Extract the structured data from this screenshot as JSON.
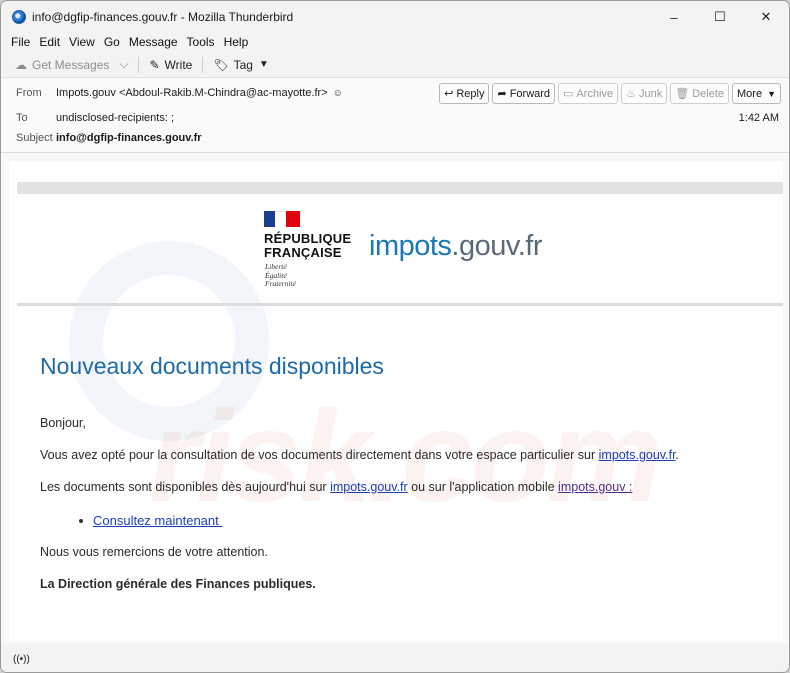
{
  "window": {
    "title": "info@dgfip-finances.gouv.fr - Mozilla Thunderbird",
    "minimize_glyph": "–",
    "maximize_glyph": "☐",
    "close_glyph": "✕"
  },
  "menu": {
    "file": "File",
    "edit": "Edit",
    "view": "View",
    "go": "Go",
    "message": "Message",
    "tools": "Tools",
    "help": "Help"
  },
  "toolbar": {
    "get_messages": "Get Messages",
    "write": "Write",
    "tag": "Tag"
  },
  "header": {
    "from_label": "From",
    "from_value": "Impots.gouv <Abdoul-Rakib.M-Chindra@ac-mayotte.fr>",
    "to_label": "To",
    "to_value": "undisclosed-recipients: ;",
    "subject_label": "Subject",
    "subject_value": "info@dgfip-finances.gouv.fr",
    "time": "1:42 AM",
    "buttons": {
      "reply": "Reply",
      "forward": "Forward",
      "archive": "Archive",
      "junk": "Junk",
      "delete": "Delete",
      "more": "More"
    }
  },
  "email": {
    "logo": {
      "republic_line1": "RÉPUBLIQUE",
      "republic_line2": "FRANÇAISE",
      "motto1": "Liberté",
      "motto2": "Égalité",
      "motto3": "Fraternité",
      "brand_part1": "impots",
      "brand_part2": ".gouv.fr"
    },
    "heading": "Nouveaux documents disponibles",
    "greeting": "Bonjour,",
    "para1_text": "Vous avez opté pour la consultation de vos documents directement dans votre espace particulier sur ",
    "para1_link": "impots.gouv.fr",
    "para1_end": ".",
    "para2_text": "Les documents  sont disponibles dès aujourd'hui sur ",
    "para2_link1": "impots.gouv.fr",
    "para2_middle": " ou sur l'application mobile ",
    "para2_link2": "impots.gouv :",
    "cta_link": "Consultez maintenant ",
    "thanks": "Nous vous remercions de votre attention.",
    "signature": "La Direction générale des Finances publiques."
  },
  "watermark": {
    "text": "risk.com"
  },
  "statusbar": {
    "icon": "((•))"
  },
  "colors": {
    "heading": "#1c6aa8",
    "link": "#1a3fb8",
    "visited_link": "#512a86",
    "flag_blue": "#1b3f8f",
    "flag_red": "#e1000f"
  }
}
